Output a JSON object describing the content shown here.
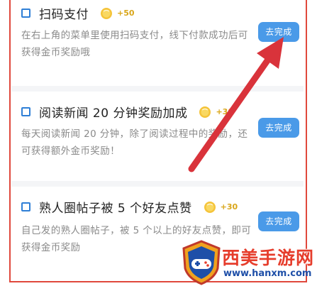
{
  "colors": {
    "frame": "#e0483c",
    "checkbox": "#2f7fd6",
    "button": "#4a9ae8",
    "reward": "#d9a61a",
    "arrow": "#d9333b"
  },
  "tasks": [
    {
      "title": "扫码支付",
      "reward": "+50",
      "icon": "coin-icon",
      "description": "在右上角的菜单里使用扫码支付，线下付款成功后可获得金币奖励哦",
      "button": "去完成"
    },
    {
      "title": "阅读新闻 20 分钟奖励加成",
      "reward": "+30",
      "icon": "coin-icon",
      "description": "每天阅读新闻 20 分钟，除了阅读过程中的奖励，还可获得额外金币奖励！",
      "button": "去完成"
    },
    {
      "title": "熟人圈帖子被 5 个好友点赞",
      "reward": "+30",
      "icon": "coin-icon",
      "description": "自己发的熟人圈帖子，被 5 个以上的好友点赞，即可获得金币奖励",
      "button": "去完成"
    }
  ],
  "watermark": {
    "name": "西美手游网",
    "url": "www.hanxm.com",
    "icon": "gamepad-shield-logo"
  }
}
